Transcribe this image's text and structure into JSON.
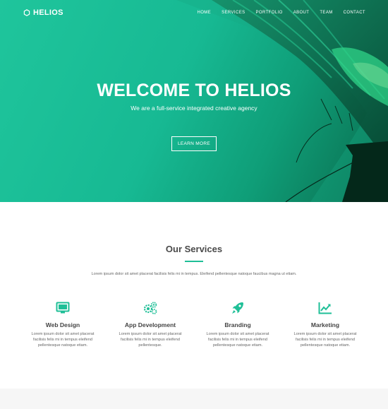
{
  "brand": {
    "name": "HELIOS",
    "icon": "helios-logo-icon"
  },
  "nav": {
    "items": [
      "HOME",
      "SERVICES",
      "PORTFOLIO",
      "ABOUT",
      "TEAM",
      "CONTACT"
    ]
  },
  "hero": {
    "title_light": "WELCOME TO",
    "title_bold": "HELIOS",
    "subtitle": "We are a full-service integrated creative agency",
    "button_label": "LEARN MORE"
  },
  "services": {
    "title": "Our Services",
    "description": "Lorem ipsum dolor sit amet placerat facilisis felis mi in tempus. Eleifend pellentesque natoque faucibus magna ut etiam.",
    "items": [
      {
        "icon": "monitor-icon",
        "name": "Web Design",
        "text": "Lorem ipsum dolor sit amet placerat facilisis felis mi in tempus eleifend pellentesque natoque etiam."
      },
      {
        "icon": "gears-icon",
        "name": "App Development",
        "text": "Lorem ipsum dolor sit amet placerat facilisis felis mi in tempus eleifend pellentesque."
      },
      {
        "icon": "rocket-icon",
        "name": "Branding",
        "text": "Lorem ipsum dolor sit amet placerat facilisis felis mi in tempus eleifend pellentesque natoque etiam."
      },
      {
        "icon": "chart-line-icon",
        "name": "Marketing",
        "text": "Lorem ipsum dolor sit amet placerat facilisis felis mi in tempus eleifend pellentesque natoque etiam."
      }
    ]
  },
  "colors": {
    "accent": "#1fbf97",
    "hero_dark": "#0a6a4c"
  }
}
